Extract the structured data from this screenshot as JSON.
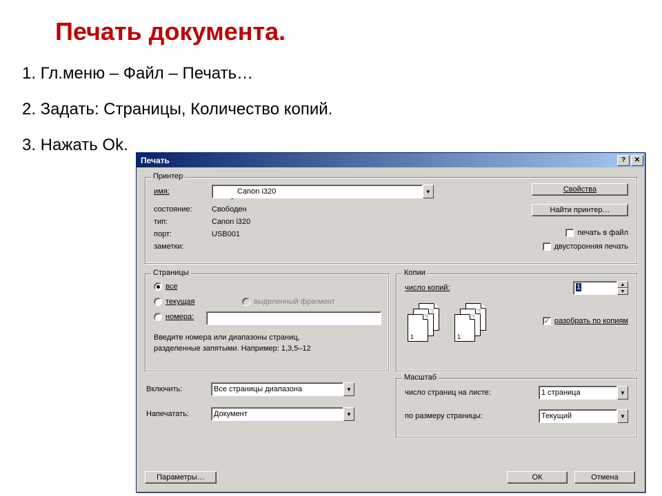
{
  "slide": {
    "heading": "Печать документа.",
    "step1": "1. Гл.меню – Файл – Печать…",
    "step2": "2. Задать: Страницы, Количество копий.",
    "step3": "3. Нажать Ok."
  },
  "dialog": {
    "title": "Печать",
    "help_btn": "?",
    "close_btn": "✕",
    "printer_group": {
      "legend": "Принтер",
      "name_label": "имя:",
      "name_value": "Canon i320",
      "status_label": "состояние:",
      "status_value": "Свободен",
      "type_label": "тип:",
      "type_value": "Canon i320",
      "port_label": "порт:",
      "port_value": "USB001",
      "notes_label": "заметки:",
      "properties_btn": "Свойства",
      "find_printer_btn": "Найти принтер…",
      "print_to_file": "печать в файл",
      "duplex": "двусторонняя печать"
    },
    "pages_group": {
      "legend": "Страницы",
      "all": "все",
      "current": "текущая",
      "selection": "выделенный фрагмент",
      "numbers": "номера:",
      "hint1": "Введите номера или диапазоны страниц,",
      "hint2": "разделенные запятыми. Например: 1,3,5–12"
    },
    "copies_group": {
      "legend": "Копии",
      "copies_label": "число копий:",
      "copies_value": "1",
      "collate": "разобрать по копиям"
    },
    "include_label": "Включить:",
    "include_value": "Все страницы диапазона",
    "printwhat_label": "Напечатать:",
    "printwhat_value": "Документ",
    "scale_group": {
      "legend": "Масштаб",
      "pages_per_sheet_label": "число страниц на листе:",
      "pages_per_sheet_value": "1 страница",
      "fit_label": "по размеру страницы:",
      "fit_value": "Текущий"
    },
    "options_btn": "Параметры…",
    "ok_btn": "ОК",
    "cancel_btn": "Отмена"
  }
}
